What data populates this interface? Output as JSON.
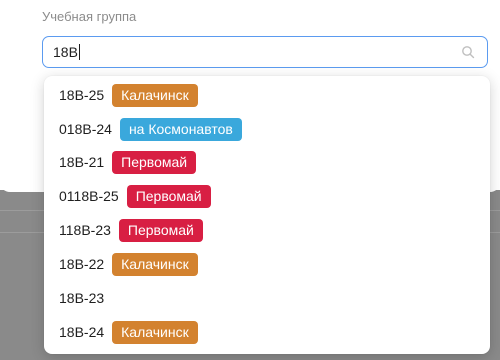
{
  "form": {
    "field_label": "Учебная группа",
    "search_value": "18В"
  },
  "badge_colors": {
    "Калачинск": "#d3822f",
    "на Космонавтов": "#3aa8dc",
    "Первомай": "#d81f43"
  },
  "options": [
    {
      "code": "18В-25",
      "campus": "Калачинск"
    },
    {
      "code": "018В-24",
      "campus": "на Космонавтов"
    },
    {
      "code": "18В-21",
      "campus": "Первомай"
    },
    {
      "code": "0118В-25",
      "campus": "Первомай"
    },
    {
      "code": "118В-23",
      "campus": "Первомай"
    },
    {
      "code": "18В-22",
      "campus": "Калачинск"
    },
    {
      "code": "18В-23",
      "campus": ""
    },
    {
      "code": "18В-24",
      "campus": "Калачинск"
    }
  ]
}
